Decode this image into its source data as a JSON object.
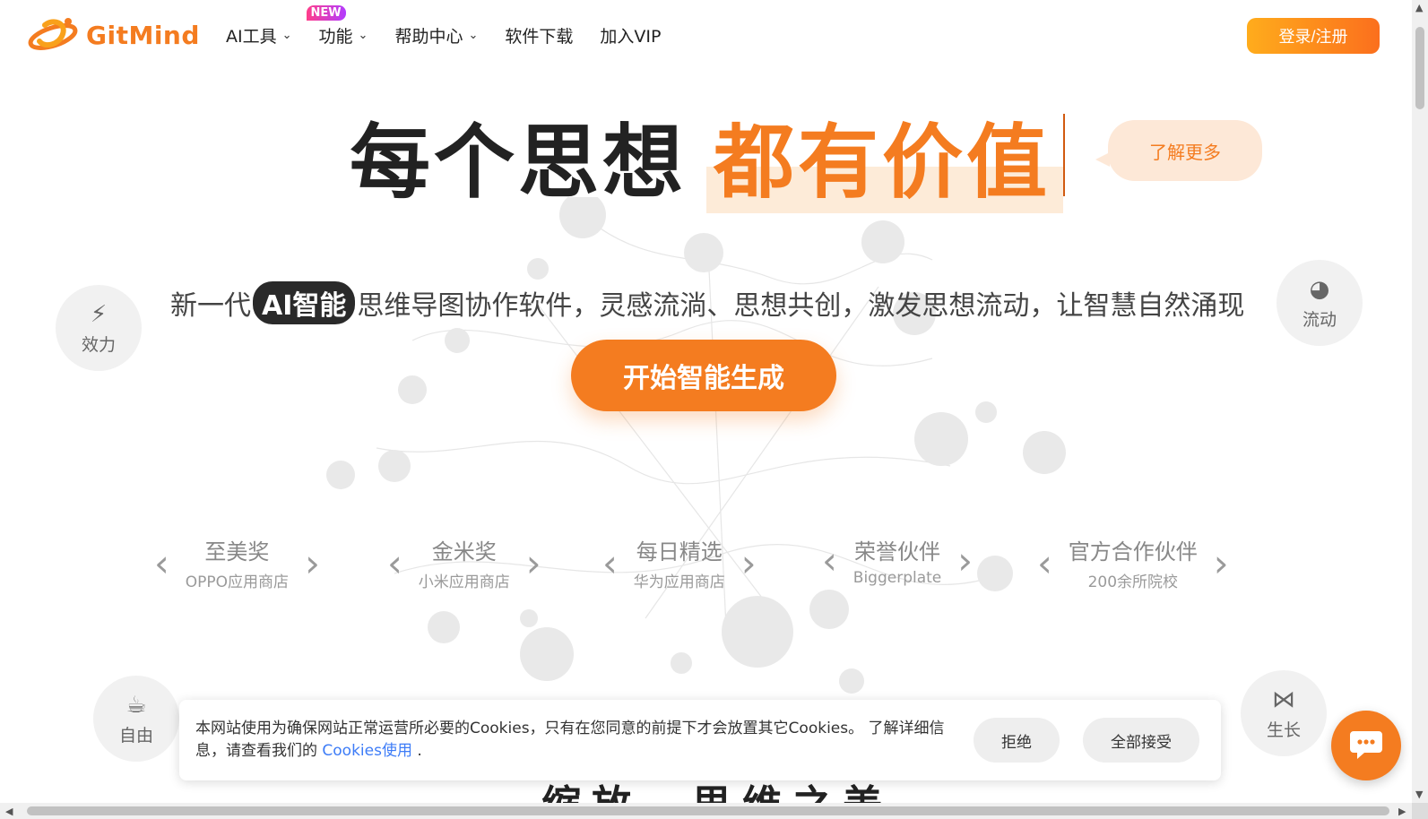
{
  "header": {
    "logo_text": "GitMind",
    "nav": [
      {
        "label": "AI工具",
        "has_dropdown": true
      },
      {
        "label": "功能",
        "has_dropdown": true,
        "badge": "NEW"
      },
      {
        "label": "帮助中心",
        "has_dropdown": true
      },
      {
        "label": "软件下载",
        "has_dropdown": false
      },
      {
        "label": "加入VIP",
        "has_dropdown": false
      }
    ],
    "login_label": "登录/注册"
  },
  "hero": {
    "title_dark": "每个思想",
    "title_orange": "都有价值",
    "learn_more": "了解更多",
    "subtitle_before": "新一代",
    "subtitle_pill": "AI智能",
    "subtitle_after": "思维导图协作软件，灵感流淌、思想共创，激发思想流动，让智慧自然涌现",
    "cta": "开始智能生成"
  },
  "bubbles": {
    "efficiency": {
      "label": "效力",
      "icon": "lightning-icon"
    },
    "flow": {
      "label": "流动",
      "icon": "globe-icon"
    },
    "freedom": {
      "label": "自由",
      "icon": "coffee-icon"
    },
    "growth": {
      "label": "生长",
      "icon": "sprout-icon"
    }
  },
  "awards": [
    {
      "title": "至美奖",
      "sub": "OPPO应用商店"
    },
    {
      "title": "金米奖",
      "sub": "小米应用商店"
    },
    {
      "title": "每日精选",
      "sub": "华为应用商店"
    },
    {
      "title": "荣誉伙伴",
      "sub": "Biggerplate"
    },
    {
      "title": "官方合作伙伴",
      "sub": "200余所院校"
    }
  ],
  "cookie": {
    "text_line1": "本网站使用为确保网站正常运营所必要的Cookies，只有在您同意的前提下才会放置其它Cookies。 了解详细信",
    "text_line2": "息，请查看我们的",
    "link": "Cookies使用",
    "period": ".",
    "reject": "拒绝",
    "accept": "全部接受"
  },
  "below_title": "缩放，思维之美",
  "colors": {
    "brand_orange": "#f47c20",
    "cta_gradient_start": "#ffac1c",
    "cta_gradient_end": "#fb6f1d"
  }
}
